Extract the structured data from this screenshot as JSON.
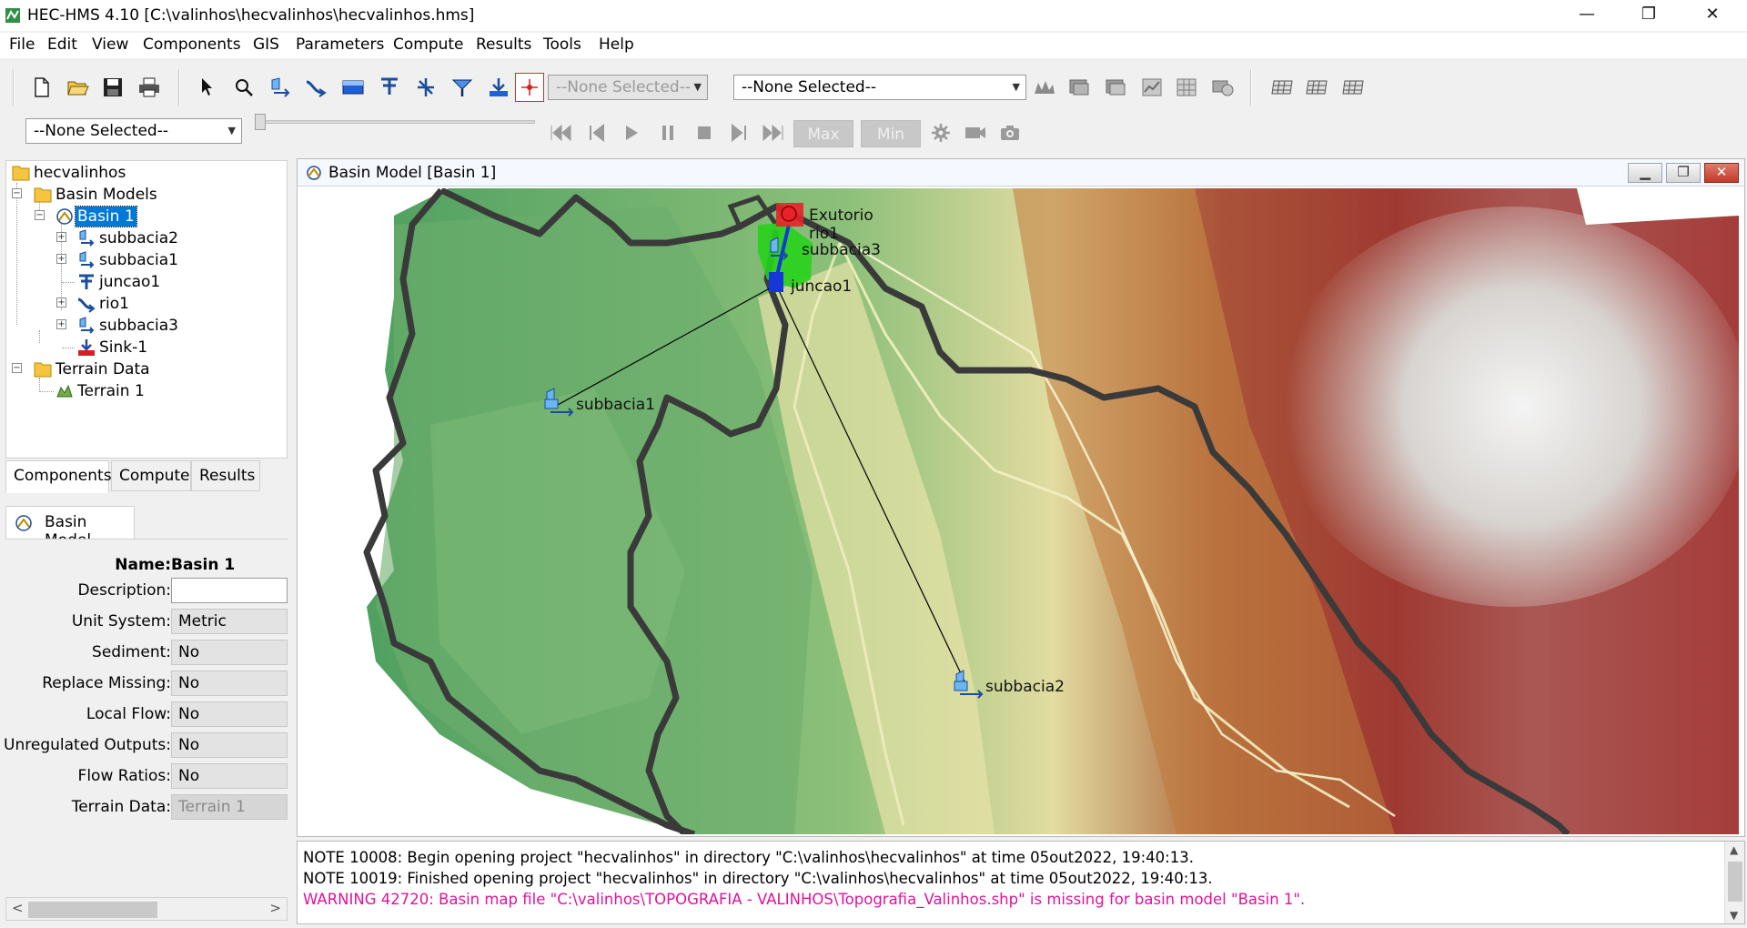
{
  "window": {
    "title": "HEC-HMS 4.10 [C:\\valinhos\\hecvalinhos\\hecvalinhos.hms]",
    "minimize": "—",
    "restore": "❐",
    "close": "✕"
  },
  "menu": [
    "File",
    "Edit",
    "View",
    "Components",
    "GIS",
    "Parameters",
    "Compute",
    "Results",
    "Tools",
    "Help"
  ],
  "toolbar": {
    "element_combo": "--None Selected--",
    "run_combo": "--None Selected--",
    "time_combo": "--None Selected--",
    "max_label": "Max",
    "min_label": "Min"
  },
  "tree": {
    "root": "hecvalinhos",
    "basin_models": "Basin Models",
    "basin1": "Basin 1",
    "elements": [
      "subbacia2",
      "subbacia1",
      "juncao1",
      "rio1",
      "subbacia3",
      "Sink-1"
    ],
    "terrain_data": "Terrain Data",
    "terrain1": "Terrain 1"
  },
  "left_tabs": [
    "Components",
    "Compute",
    "Results"
  ],
  "editor": {
    "tab": "Basin Model",
    "name_label": "Name:",
    "name_value": "Basin 1",
    "fields": [
      {
        "label": "Description:",
        "value": ""
      },
      {
        "label": "Unit System:",
        "value": "Metric"
      },
      {
        "label": "Sediment:",
        "value": "No"
      },
      {
        "label": "Replace Missing:",
        "value": "No"
      },
      {
        "label": "Local Flow:",
        "value": "No"
      },
      {
        "label": "Unregulated Outputs:",
        "value": "No"
      },
      {
        "label": "Flow Ratios:",
        "value": "No"
      },
      {
        "label": "Terrain Data:",
        "value": "Terrain 1"
      }
    ]
  },
  "basin_window": {
    "title": "Basin Model [Basin 1]",
    "labels": {
      "exutorio": "Exutorio",
      "rio1": "rio1",
      "subbacia3": "subbacia3",
      "juncao1": "juncao1",
      "subbacia1": "subbacia1",
      "subbacia2": "subbacia2"
    }
  },
  "messages": [
    "NOTE 10008:  Begin opening project \"hecvalinhos\" in directory \"C:\\valinhos\\hecvalinhos\" at time 05out2022, 19:40:13.",
    "NOTE 10019:  Finished opening project \"hecvalinhos\" in directory \"C:\\valinhos\\hecvalinhos\" at time 05out2022, 19:40:13.",
    "WARNING 42720:  Basin map file \"C:\\valinhos\\TOPOGRAFIA - VALINHOS\\Topografia_Valinhos.shp\" is missing for basin model \"Basin 1\"."
  ],
  "colors": {
    "selection": "#0078d7",
    "warning": "#e0129a",
    "boundary": "#3a3a3a",
    "outlet_red": "#e8212a",
    "subbasin_green": "#27d11c"
  }
}
